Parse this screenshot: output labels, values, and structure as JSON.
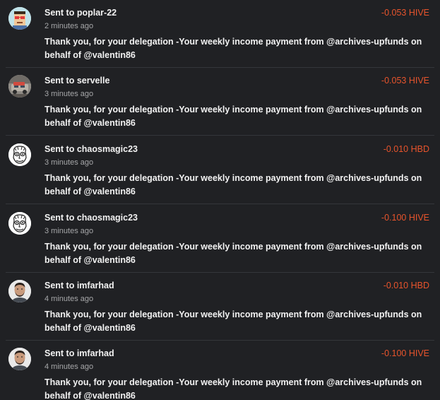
{
  "transfers": [
    {
      "title": "Sent to poplar-22",
      "time": "2 minutes ago",
      "amount": "-0.053 HIVE",
      "memo": "Thank you, for your delegation -Your weekly income payment from @archives-upfunds on behalf of @valentin86",
      "avatar": "pixel-art-avatar"
    },
    {
      "title": "Sent to servelle",
      "time": "3 minutes ago",
      "amount": "-0.053 HIVE",
      "memo": "Thank you, for your delegation -Your weekly income payment from @archives-upfunds on behalf of @valentin86",
      "avatar": "car-photo-avatar"
    },
    {
      "title": "Sent to chaosmagic23",
      "time": "3 minutes ago",
      "amount": "-0.010 HBD",
      "memo": "Thank you, for your delegation -Your weekly income payment from @archives-upfunds on behalf of @valentin86",
      "avatar": "sketch-face-avatar"
    },
    {
      "title": "Sent to chaosmagic23",
      "time": "3 minutes ago",
      "amount": "-0.100 HIVE",
      "memo": "Thank you, for your delegation -Your weekly income payment from @archives-upfunds on behalf of @valentin86",
      "avatar": "sketch-face-avatar"
    },
    {
      "title": "Sent to imfarhad",
      "time": "4 minutes ago",
      "amount": "-0.010 HBD",
      "memo": "Thank you, for your delegation -Your weekly income payment from @archives-upfunds on behalf of @valentin86",
      "avatar": "man-photo-avatar"
    },
    {
      "title": "Sent to imfarhad",
      "time": "4 minutes ago",
      "amount": "-0.100 HIVE",
      "memo": "Thank you, for your delegation -Your weekly income payment from @archives-upfunds on behalf of @valentin86",
      "avatar": "man-photo-avatar"
    }
  ],
  "colors": {
    "background": "#202124",
    "amount": "#e8542c",
    "text": "#f2f2f2",
    "muted": "#a6a7a9"
  }
}
